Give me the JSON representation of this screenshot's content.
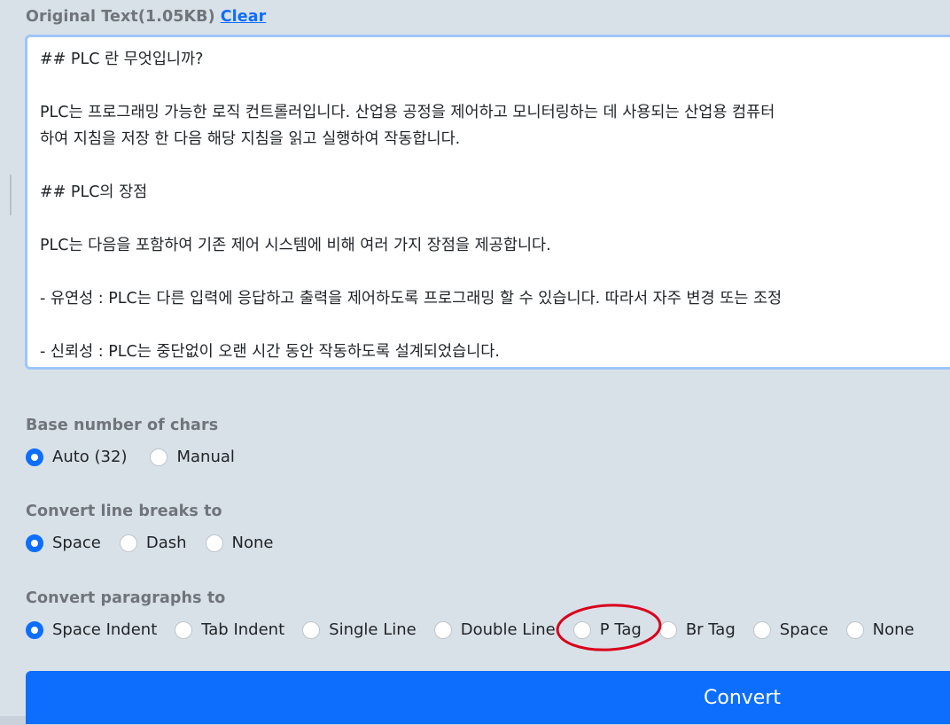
{
  "original_text": {
    "label": "Original Text(1.05KB)",
    "clear_label": "Clear",
    "content": "## PLC 란 무엇입니까?\n\nPLC는 프로그래밍 가능한 로직 컨트롤러입니다. 산업용 공정을 제어하고 모니터링하는 데 사용되는 산업용 컴퓨터\n하여 지침을 저장 한 다음 해당 지침을 읽고 실행하여 작동합니다.\n\n## PLC의 장점\n\nPLC는 다음을 포함하여 기존 제어 시스템에 비해 여러 가지 장점을 제공합니다.\n\n- 유연성 : PLC는 다른 입력에 응답하고 출력을 제어하도록 프로그래밍 할 수 있습니다. 따라서 자주 변경 또는 조정\n\n- 신뢰성 : PLC는 중단없이 오랜 시간 동안 작동하도록 설계되었습니다."
  },
  "base_chars": {
    "label": "Base number of chars",
    "options": [
      "Auto (32)",
      "Manual"
    ],
    "selected": "Auto (32)"
  },
  "line_breaks": {
    "label": "Convert line breaks to",
    "options": [
      "Space",
      "Dash",
      "None"
    ],
    "selected": "Space"
  },
  "paragraphs": {
    "label": "Convert paragraphs to",
    "options": [
      "Space Indent",
      "Tab Indent",
      "Single Line",
      "Double Line",
      "P Tag",
      "Br Tag",
      "Space",
      "None"
    ],
    "selected": "Space Indent"
  },
  "convert_label": "Convert",
  "colors": {
    "accent": "#0d6efd",
    "background": "#d9e1e8",
    "annotation": "#d9001b"
  }
}
